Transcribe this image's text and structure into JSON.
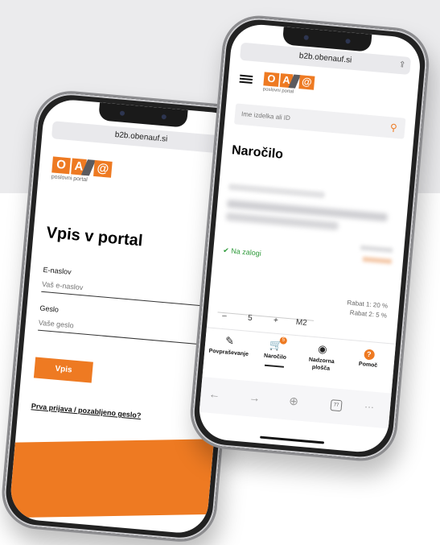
{
  "colors": {
    "accent": "#ee7a22",
    "stock_green": "#2e9a3a",
    "background_band": "#ebebed"
  },
  "left_phone": {
    "url": "b2b.obenauf.si",
    "logo": {
      "o": "O",
      "a": "A",
      "at": "@",
      "subtitle": "poslovni portal"
    },
    "title": "Vpis v portal",
    "email_label": "E-naslov",
    "email_placeholder": "Vaš e-naslov",
    "password_label": "Geslo",
    "password_placeholder": "Vaše geslo",
    "login_button": "Vpis",
    "reset_link": "Prva prijava / pozabljeno geslo?"
  },
  "right_phone": {
    "url": "b2b.obenauf.si",
    "logo": {
      "o": "O",
      "a": "A",
      "at": "@",
      "subtitle": "poslovni portal"
    },
    "search_placeholder": "Ime izdelka ali ID",
    "title": "Naročilo",
    "stock_status": "Na zalogi",
    "rabat1": "Rabat 1:   20 %",
    "rabat2": "Rabat 2:     5 %",
    "qty": {
      "minus": "–",
      "value": "5",
      "plus": "+",
      "unit": "M2"
    },
    "nav": [
      {
        "label": "Povpraševanje",
        "icon": "inquiry-icon"
      },
      {
        "label": "Naročilo",
        "icon": "cart-icon",
        "badge": "5"
      },
      {
        "label": "Nadzorna plošča",
        "icon": "dashboard-icon"
      },
      {
        "label": "Pomoč",
        "icon": "help-icon"
      }
    ],
    "browser": {
      "tabs_count": "77",
      "more": "···"
    }
  }
}
